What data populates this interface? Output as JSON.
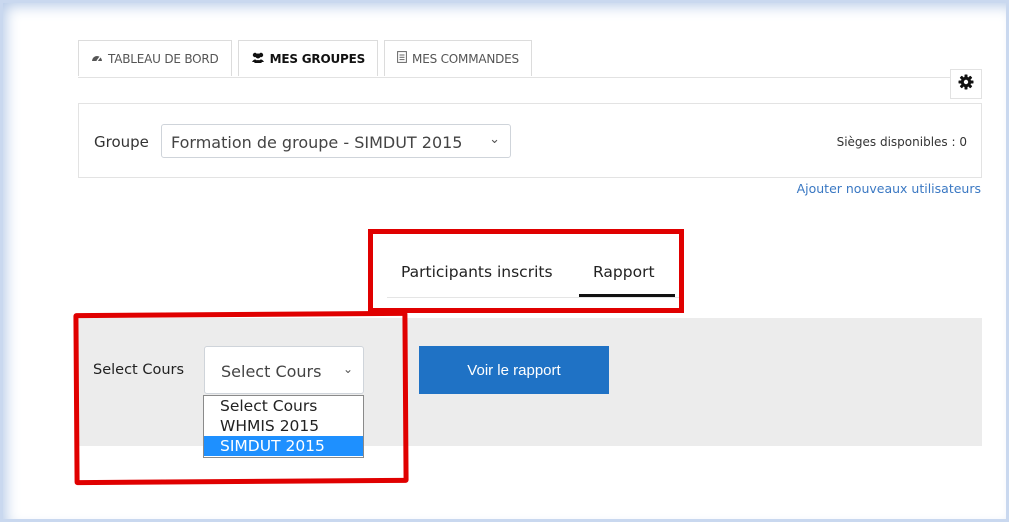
{
  "tabs": [
    {
      "label": "TABLEAU DE BORD",
      "icon": "dashboard-icon",
      "active": false
    },
    {
      "label": "MES GROUPES",
      "icon": "users-icon",
      "active": true
    },
    {
      "label": "MES COMMANDES",
      "icon": "document-icon",
      "active": false
    }
  ],
  "settings": {
    "icon": "gear-icon"
  },
  "group": {
    "label": "Groupe",
    "selected": "Formation de groupe - SIMDUT 2015",
    "seats_label": "Sièges disponibles :",
    "seats_value": "0"
  },
  "add_users_link": "Ajouter nouveaux utilisateurs",
  "report_tabs": [
    {
      "label": "Participants inscrits",
      "active": false
    },
    {
      "label": "Rapport",
      "active": true
    }
  ],
  "report": {
    "course_label": "Select Cours",
    "course_selected": "Select Cours",
    "course_options": [
      "Select Cours",
      "WHMIS 2015",
      "SIMDUT 2015"
    ],
    "highlighted_option": "SIMDUT 2015",
    "view_button": "Voir le rapport"
  },
  "colors": {
    "accent": "#1f72c5",
    "link": "#3a78c3",
    "annotation": "#e00000",
    "option_highlight": "#1e90ff"
  }
}
